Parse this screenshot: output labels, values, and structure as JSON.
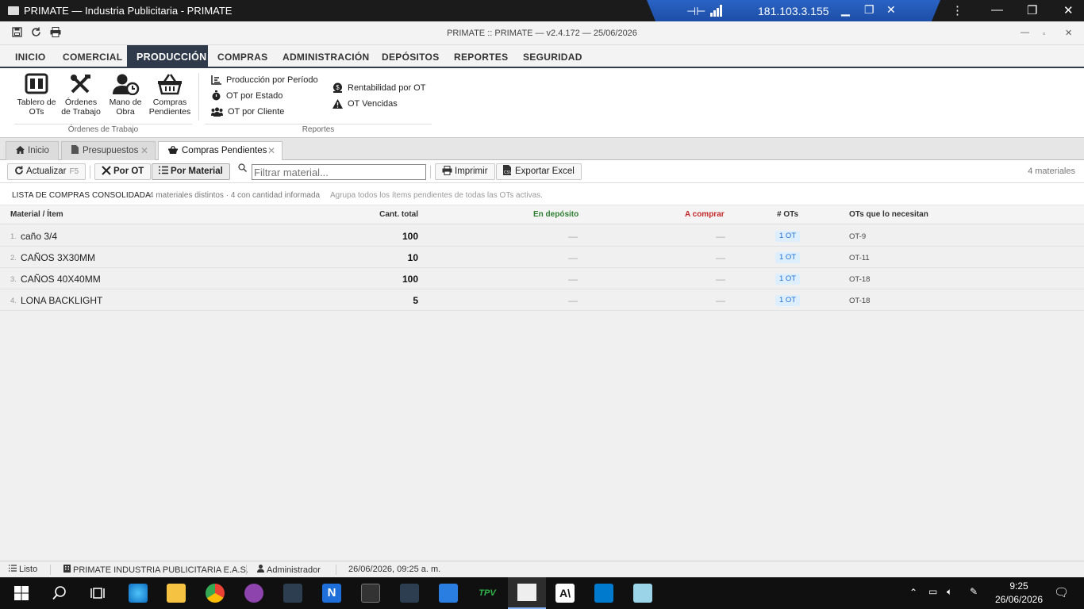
{
  "rdp": {
    "title": "PRIMATE — Industria Publicitaria - PRIMATE",
    "ip": "181.103.3.155"
  },
  "app": {
    "title": "PRIMATE :: PRIMATE — v2.4.172 — 25/06/2026"
  },
  "menu": [
    "INICIO",
    "COMERCIAL",
    "PRODUCCIÓN",
    "COMPRAS",
    "ADMINISTRACIÓN",
    "DEPÓSITOS",
    "REPORTES",
    "SEGURIDAD"
  ],
  "ribbon": {
    "ot_buttons": [
      {
        "l1": "Tablero de",
        "l2": "OTs"
      },
      {
        "l1": "Órdenes",
        "l2": "de Trabajo"
      },
      {
        "l1": "Mano de",
        "l2": "Obra"
      },
      {
        "l1": "Compras",
        "l2": "Pendientes"
      }
    ],
    "ot_group": "Órdenes de Trabajo",
    "reports_col1": [
      "Producción por Período",
      "OT por Estado",
      "OT por Cliente"
    ],
    "reports_col2": [
      "Rentabilidad por OT",
      "OT Vencidas"
    ],
    "reports_group": "Reportes"
  },
  "tabs": [
    "Inicio",
    "Presupuestos",
    "Compras Pendientes"
  ],
  "toolbar": {
    "refresh": "Actualizar",
    "refresh_key": "F5",
    "by_ot": "Por OT",
    "by_material": "Por Material",
    "filter_placeholder": "Filtrar material...",
    "print": "Imprimir",
    "export": "Exportar Excel",
    "count": "4 materiales"
  },
  "list": {
    "title": "LISTA DE COMPRAS CONSOLIDADA",
    "summary": "4 materiales distintos · 4 con cantidad informada",
    "hint": "Agrupa todos los ítems pendientes de todas las OTs activas."
  },
  "columns": {
    "material": "Material / Ítem",
    "qty": "Cant. total",
    "stock": "En depósito",
    "buy": "A comprar",
    "ots": "# OTs",
    "ot_list": "OTs que lo necesitan"
  },
  "rows": [
    {
      "n": "1.",
      "name": "caño 3/4",
      "qty": "100",
      "stock": "—",
      "buy": "—",
      "ots": "1 OT",
      "ot_list": "OT-9"
    },
    {
      "n": "2.",
      "name": "CAÑOS 3X30MM",
      "qty": "10",
      "stock": "—",
      "buy": "—",
      "ots": "1 OT",
      "ot_list": "OT-11"
    },
    {
      "n": "3.",
      "name": "CAÑOS 40X40MM",
      "qty": "100",
      "stock": "—",
      "buy": "—",
      "ots": "1 OT",
      "ot_list": "OT-18"
    },
    {
      "n": "4.",
      "name": "LONA BACKLIGHT",
      "qty": "5",
      "stock": "—",
      "buy": "—",
      "ots": "1 OT",
      "ot_list": "OT-18"
    }
  ],
  "status": {
    "state": "Listo",
    "company": "PRIMATE INDUSTRIA PUBLICITARIA E.A.S.",
    "user": "Administrador",
    "datetime": "26/06/2026, 09:25 a. m."
  },
  "taskbar": {
    "time": "9:25",
    "date": "26/06/2026",
    "tpv": "TPV"
  },
  "colors": {
    "stock_header": "#2e7d32",
    "buy_header": "#c62828",
    "menu_active": "#2f3b4a"
  }
}
